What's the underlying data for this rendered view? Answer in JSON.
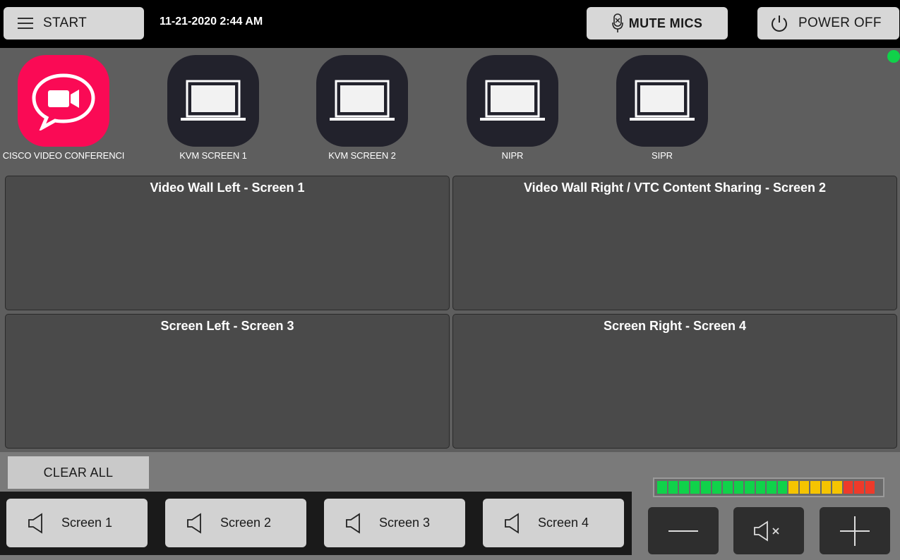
{
  "topbar": {
    "start_label": "START",
    "datetime": "11-21-2020 2:44 AM",
    "mute_label": "MUTE MICS",
    "power_label": "POWER OFF"
  },
  "status": {
    "online_color": "#10d24a"
  },
  "sources": [
    {
      "label": "CISCO VIDEO CONFERENCI",
      "icon": "video-chat-icon",
      "color": "#fa0a55"
    },
    {
      "label": "KVM SCREEN 1",
      "icon": "laptop-icon"
    },
    {
      "label": "KVM SCREEN 2",
      "icon": "laptop-icon"
    },
    {
      "label": "NIPR",
      "icon": "laptop-icon"
    },
    {
      "label": "SIPR",
      "icon": "laptop-icon"
    }
  ],
  "screens": [
    {
      "title": "Video Wall Left - Screen 1"
    },
    {
      "title": "Video Wall Right / VTC Content Sharing - Screen 2"
    },
    {
      "title": "Screen Left - Screen 3"
    },
    {
      "title": "Screen Right - Screen 4"
    }
  ],
  "clear_label": "CLEAR ALL",
  "audio_buttons": [
    {
      "label": "Screen 1",
      "icon": "speaker-icon"
    },
    {
      "label": "Screen 2",
      "icon": "speaker-icon"
    },
    {
      "label": "Screen 3",
      "icon": "speaker-icon"
    },
    {
      "label": "Screen 4",
      "icon": "speaker-icon"
    }
  ],
  "level_meter": {
    "segments": [
      "#10d24a",
      "#10d24a",
      "#10d24a",
      "#10d24a",
      "#10d24a",
      "#10d24a",
      "#10d24a",
      "#10d24a",
      "#10d24a",
      "#10d24a",
      "#10d24a",
      "#10d24a",
      "#f5c400",
      "#f5c400",
      "#f5c400",
      "#f5c400",
      "#f5c400",
      "#ee3a2a",
      "#ee3a2a",
      "#ee3a2a"
    ]
  },
  "volume_controls": {
    "down_icon": "minus-icon",
    "mute_icon": "speaker-mute-icon",
    "up_icon": "plus-icon"
  }
}
